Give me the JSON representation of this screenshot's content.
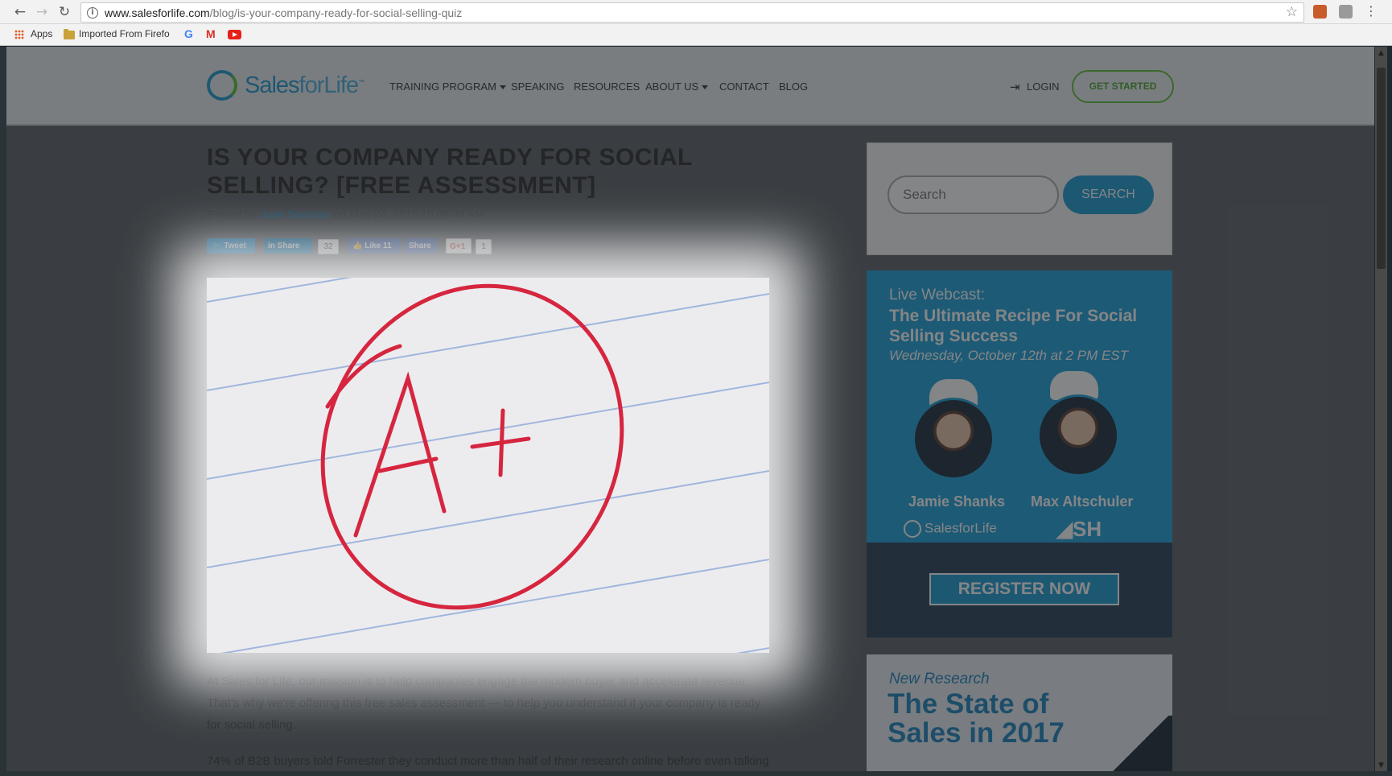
{
  "browser": {
    "url_domain": "www.salesforlife.com",
    "url_path": "/blog/is-your-company-ready-for-social-selling-quiz",
    "bookmarks": [
      "Apps",
      "Imported From Firefo"
    ]
  },
  "site": {
    "logo": "Sales for Life",
    "nav": [
      "TRAINING PROGRAM",
      "SPEAKING",
      "RESOURCES",
      "ABOUT US",
      "CONTACT",
      "BLOG"
    ],
    "login": "LOGIN",
    "get_started": "GET STARTED"
  },
  "article": {
    "title": "IS YOUR COMPANY READY FOR SOCIAL SELLING? [FREE ASSESSMENT]",
    "posted_by": "Posted by",
    "author": "Jose Sanchez",
    "date": "on May 24, 2016 10:08:46 AM",
    "share": {
      "tweet": "Tweet",
      "linkedin": "Share",
      "linkedin_count": "32",
      "fb_like": "Like 11",
      "fb_share": "Share",
      "gplus": "G+1",
      "gplus_count": "1"
    },
    "hero_text": "A+",
    "para1": "At Sales for Life, our mission is to help companies engage the modern buyer and accelerate revenue. That's why we're offering this free sales assessment — to help you understand if your company is ready for social selling.",
    "para2": "74% of B2B buyers told Forrester they conduct more than half of their research online before even talking"
  },
  "sidebar": {
    "search_placeholder": "Search",
    "search_button": "SEARCH",
    "webcast": {
      "label": "Live Webcast:",
      "title": "The Ultimate Recipe For Social Selling Success",
      "date": "Wednesday, October 12th at 2 PM EST",
      "speaker1": "Jamie Shanks",
      "speaker2": "Max Altschuler",
      "brand1": "SalesforLife",
      "brand2": "SH",
      "cta": "REGISTER NOW"
    },
    "research": {
      "label": "New Research",
      "title": "The State of Sales in 2017"
    }
  },
  "colors": {
    "brand_blue": "#1e9bd1",
    "brand_green": "#5fbf3b",
    "grade_red": "#d6263f"
  }
}
